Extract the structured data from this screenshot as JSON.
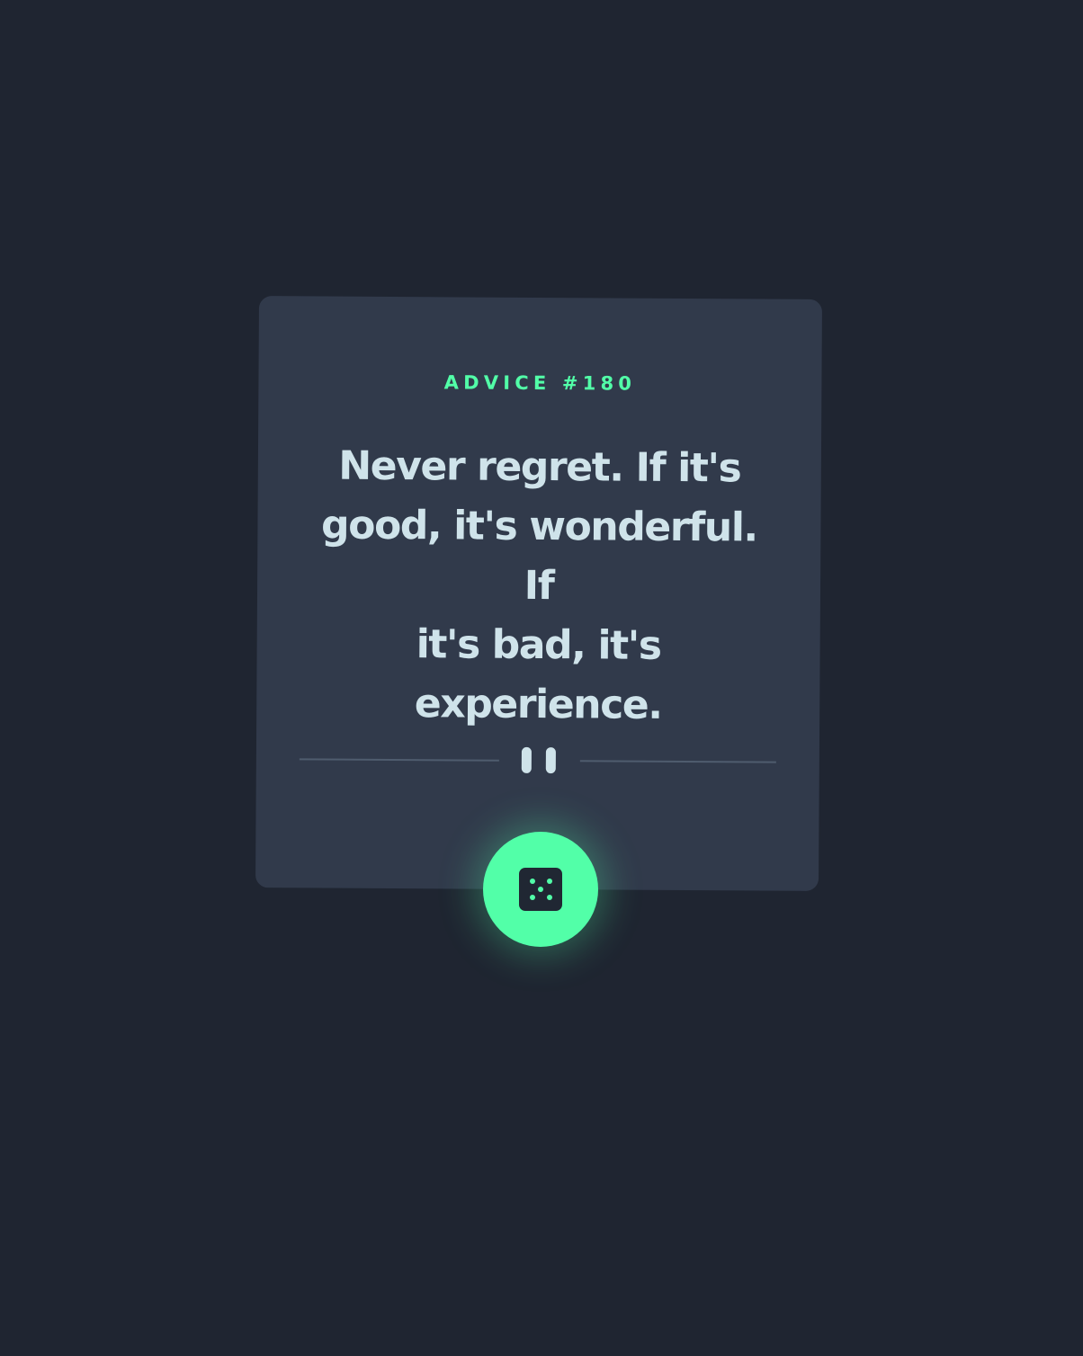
{
  "advice": {
    "id_label": "ADVICE #180",
    "quote_lines": [
      "Never regret. If it's",
      "good, it's wonderful. If",
      "it's bad, it's",
      "experience."
    ]
  },
  "divider": {
    "icon": "pause-icon"
  },
  "generate_button": {
    "icon": "dice-icon"
  },
  "colors": {
    "background": "#1f2531",
    "card": "#313a4b",
    "accent": "#52ffa8",
    "text": "#cfe3ea",
    "divider": "#4f5c6e"
  }
}
